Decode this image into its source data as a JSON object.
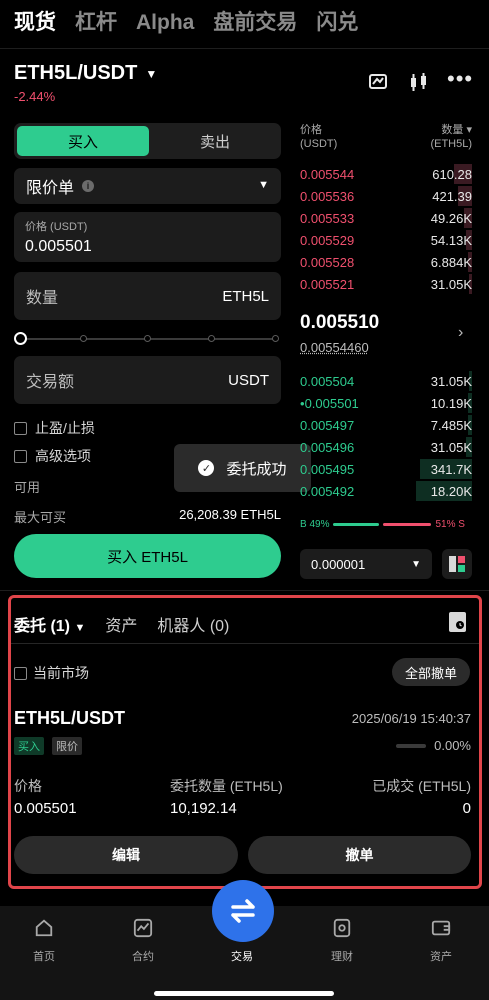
{
  "top_tabs": [
    "现货",
    "杠杆",
    "Alpha",
    "盘前交易",
    "闪兑"
  ],
  "pair": {
    "name": "ETH5L/USDT",
    "change": "-2.44%"
  },
  "trade": {
    "buy_label": "买入",
    "sell_label": "卖出",
    "order_type": "限价单",
    "price_label": "价格 (USDT)",
    "price_value": "0.005501",
    "qty_label": "数量",
    "qty_unit": "ETH5L",
    "amount_label": "交易额",
    "amount_unit": "USDT",
    "tpsl_label": "止盈/止损",
    "advanced_label": "高级选项",
    "available_label": "可用",
    "maxbuy_label": "最大可买",
    "maxbuy_value": "26,208.39 ETH5L",
    "buy_button": "买入 ETH5L",
    "slider_value_pct": 0
  },
  "toast": "委托成功",
  "orderbook": {
    "price_header": "价格",
    "price_unit": "(USDT)",
    "qty_header": "数量",
    "qty_unit": "(ETH5L)",
    "asks": [
      {
        "price": "0.005544",
        "qty": "610.28"
      },
      {
        "price": "0.005536",
        "qty": "421.39"
      },
      {
        "price": "0.005533",
        "qty": "49.26K"
      },
      {
        "price": "0.005529",
        "qty": "54.13K"
      },
      {
        "price": "0.005528",
        "qty": "6.884K"
      },
      {
        "price": "0.005521",
        "qty": "31.05K"
      }
    ],
    "last_price": "0.005510",
    "last_price_sub": "0.00554460",
    "bids": [
      {
        "price": "0.005504",
        "qty": "31.05K"
      },
      {
        "price": "0.005501",
        "qty": "10.19K"
      },
      {
        "price": "0.005497",
        "qty": "7.485K"
      },
      {
        "price": "0.005496",
        "qty": "31.05K"
      },
      {
        "price": "0.005495",
        "qty": "341.7K"
      },
      {
        "price": "0.005492",
        "qty": "18.20K"
      }
    ],
    "buy_ratio": "B 49%",
    "sell_ratio": "51% S",
    "precision": "0.000001"
  },
  "orders": {
    "tab_orders": "委托 (1)",
    "tab_assets": "资产",
    "tab_bots": "机器人 (0)",
    "current_market": "当前市场",
    "cancel_all": "全部撤单",
    "pair": "ETH5L/USDT",
    "time": "2025/06/19 15:40:37",
    "tag_buy": "买入",
    "tag_limit": "限价",
    "filled_pct": "0.00%",
    "price_label": "价格",
    "price_value": "0.005501",
    "qty_label": "委托数量 (ETH5L)",
    "qty_value": "10,192.14",
    "filled_label": "已成交 (ETH5L)",
    "filled_value": "0",
    "edit": "编辑",
    "cancel": "撤单"
  },
  "nav": [
    "首页",
    "合约",
    "交易",
    "理财",
    "资产"
  ],
  "colors": {
    "buy": "#2ecc8f",
    "sell": "#f0506e",
    "highlight": "#e0454a",
    "fab": "#2e72ea"
  }
}
